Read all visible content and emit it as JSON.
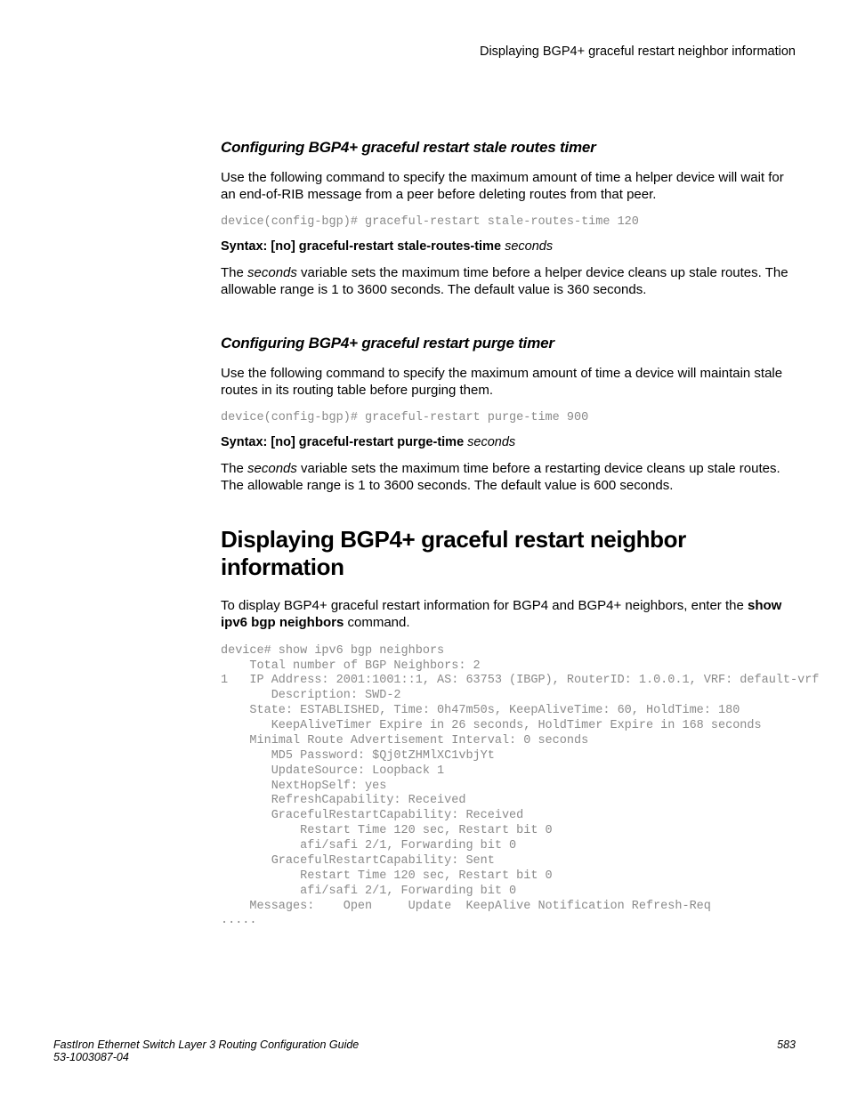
{
  "header": {
    "running": "Displaying BGP4+ graceful restart neighbor information"
  },
  "section1": {
    "heading": "Configuring BGP4+ graceful restart stale routes timer",
    "intro": "Use the following command to specify the maximum amount of time a helper device will wait for an end-of-RIB message from a peer before deleting routes from that peer.",
    "code": "device(config-bgp)# graceful-restart stale-routes-time 120",
    "syntax_prefix": "Syntax: [no] graceful-restart stale-routes-time",
    "syntax_var": " seconds",
    "body2_a": "The ",
    "body2_em": "seconds",
    "body2_b": " variable sets the maximum time before a helper device cleans up stale routes. The allowable range is 1 to 3600 seconds. The default value is 360 seconds."
  },
  "section2": {
    "heading": "Configuring BGP4+ graceful restart purge timer",
    "intro": "Use the following command to specify the maximum amount of time a device will maintain stale routes in its routing table before purging them.",
    "code": "device(config-bgp)# graceful-restart purge-time 900",
    "syntax_prefix": "Syntax: [no] graceful-restart purge-time",
    "syntax_var": " seconds",
    "body2_a": "The ",
    "body2_em": "seconds",
    "body2_b": " variable sets the maximum time before a restarting device cleans up stale routes. The allowable range is 1 to 3600 seconds. The default value is 600 seconds."
  },
  "section3": {
    "heading": "Displaying BGP4+ graceful restart neighbor information",
    "intro_a": "To display BGP4+ graceful restart information for BGP4 and BGP4+ neighbors, enter the ",
    "intro_cmd": "show ipv6 bgp neighbors",
    "intro_b": " command.",
    "code": "device# show ipv6 bgp neighbors\n    Total number of BGP Neighbors: 2\n1   IP Address: 2001:1001::1, AS: 63753 (IBGP), RouterID: 1.0.0.1, VRF: default-vrf\n       Description: SWD-2\n    State: ESTABLISHED, Time: 0h47m50s, KeepAliveTime: 60, HoldTime: 180\n       KeepAliveTimer Expire in 26 seconds, HoldTimer Expire in 168 seconds\n    Minimal Route Advertisement Interval: 0 seconds\n       MD5 Password: $Qj0tZHMlXC1vbjYt\n       UpdateSource: Loopback 1\n       NextHopSelf: yes\n       RefreshCapability: Received\n       GracefulRestartCapability: Received\n           Restart Time 120 sec, Restart bit 0\n           afi/safi 2/1, Forwarding bit 0\n       GracefulRestartCapability: Sent\n           Restart Time 120 sec, Restart bit 0\n           afi/safi 2/1, Forwarding bit 0\n    Messages:    Open     Update  KeepAlive Notification Refresh-Req\n....."
  },
  "footer": {
    "left1": "FastIron Ethernet Switch Layer 3 Routing Configuration Guide",
    "left2": "53-1003087-04",
    "right": "583"
  }
}
